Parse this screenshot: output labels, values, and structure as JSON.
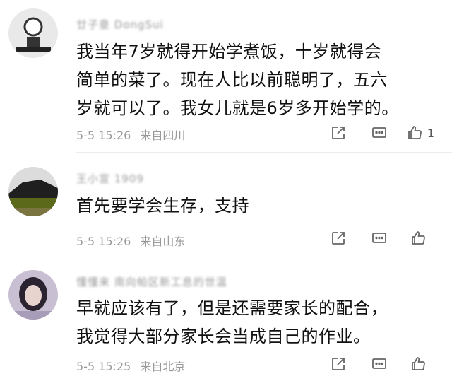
{
  "comments": [
    {
      "username": "廿子㙓 DongSui",
      "lines": [
        "我当年7岁就得开始学煮饭，十岁就得会",
        "简单的菜了。现在人比以前聪明了，五六",
        "岁就可以了。我女儿就是6岁多开始学的。"
      ],
      "time": "5-5 15:26",
      "location": "来自四川",
      "like_count": "1"
    },
    {
      "username": "王小宣 1909",
      "lines": [
        "首先要学会生存，支持"
      ],
      "time": "5-5 15:26",
      "location": "来自山东",
      "like_count": ""
    },
    {
      "username": "懂懂来 南向帕区新工息的世温",
      "lines": [
        "早就应该有了，但是还需要家长的配合，",
        "我觉得大部分家长会当成自己的作业。"
      ],
      "time": "5-5 15:25",
      "location": "来自北京",
      "like_count": ""
    }
  ],
  "icons": {
    "share": "share-icon",
    "comment": "comment-icon",
    "like": "thumbs-up-icon"
  },
  "colors": {
    "text": "#111111",
    "meta": "#999999",
    "icon": "#666666",
    "divider": "#ececec"
  }
}
